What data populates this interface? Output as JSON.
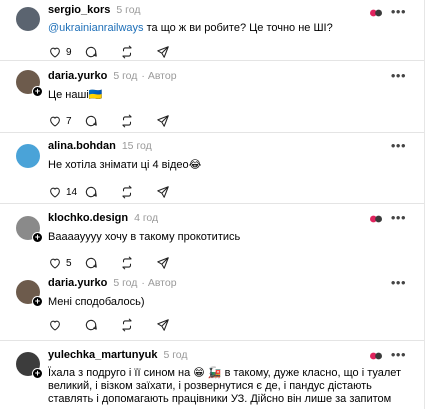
{
  "comments": [
    {
      "username": "sergio_kors",
      "time": "5 год",
      "author_label": "",
      "mention": "@ukrainianrailways",
      "text": " та що ж ви робите? Це точно не ШІ?",
      "likes": "9",
      "avatar_color": "#5b6470"
    },
    {
      "username": "daria.yurko",
      "time": "5 год",
      "author_label": "· Автор",
      "mention": "",
      "text": "Це наші🇺🇦",
      "likes": "7",
      "avatar_color": "#6d5b4c"
    },
    {
      "username": "alina.bohdan",
      "time": "15 год",
      "author_label": "",
      "mention": "",
      "text": "Не хотіла знімати ці 4 відео😂",
      "likes": "14",
      "avatar_color": "#4aa3d8"
    },
    {
      "username": "klochko.design",
      "time": "4 год",
      "author_label": "",
      "mention": "",
      "text": "Вааааyyyy хочу в такому прокотитись",
      "likes": "5",
      "avatar_color": "#8a8a8a"
    },
    {
      "username": "daria.yurko",
      "time": "5 год",
      "author_label": "· Автор",
      "mention": "",
      "text": "Мені сподобалось)",
      "likes": "",
      "avatar_color": "#6d5b4c"
    },
    {
      "username": "yulechka_martunyuk",
      "time": "5 год",
      "author_label": "",
      "mention": "",
      "text": "Їхала з подруго і її сином на 😁 🚂 в такому, дуже класно, що і туалет великий, і візком заїхати, і розвернутися є де, і пандус дістають ставлять і допомагають працівники УЗ. Дійсно він лише за запитом",
      "likes": "",
      "avatar_color": "#3c3c3c"
    }
  ],
  "icons": {
    "like": "heart-icon",
    "reply": "comment-icon",
    "repost": "repost-icon",
    "share": "share-icon",
    "more": "more-options-icon"
  },
  "more_label": "•••",
  "plus_label": "+"
}
